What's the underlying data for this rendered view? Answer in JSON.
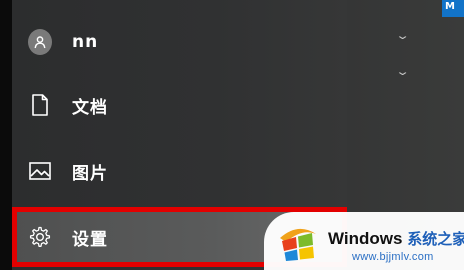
{
  "corner_badge": "M",
  "user": {
    "name": "nn"
  },
  "menu": {
    "items": [
      {
        "label": "文档",
        "icon": "document-icon"
      },
      {
        "label": "图片",
        "icon": "picture-icon"
      },
      {
        "label": "设置",
        "icon": "gear-icon"
      }
    ]
  },
  "watermark": {
    "brand": "Windows",
    "brand_cn": "系统之家",
    "url": "www.bjjmlv.com"
  },
  "colors": {
    "highlight_border": "#e30000",
    "accent_blue": "#1273c8"
  }
}
